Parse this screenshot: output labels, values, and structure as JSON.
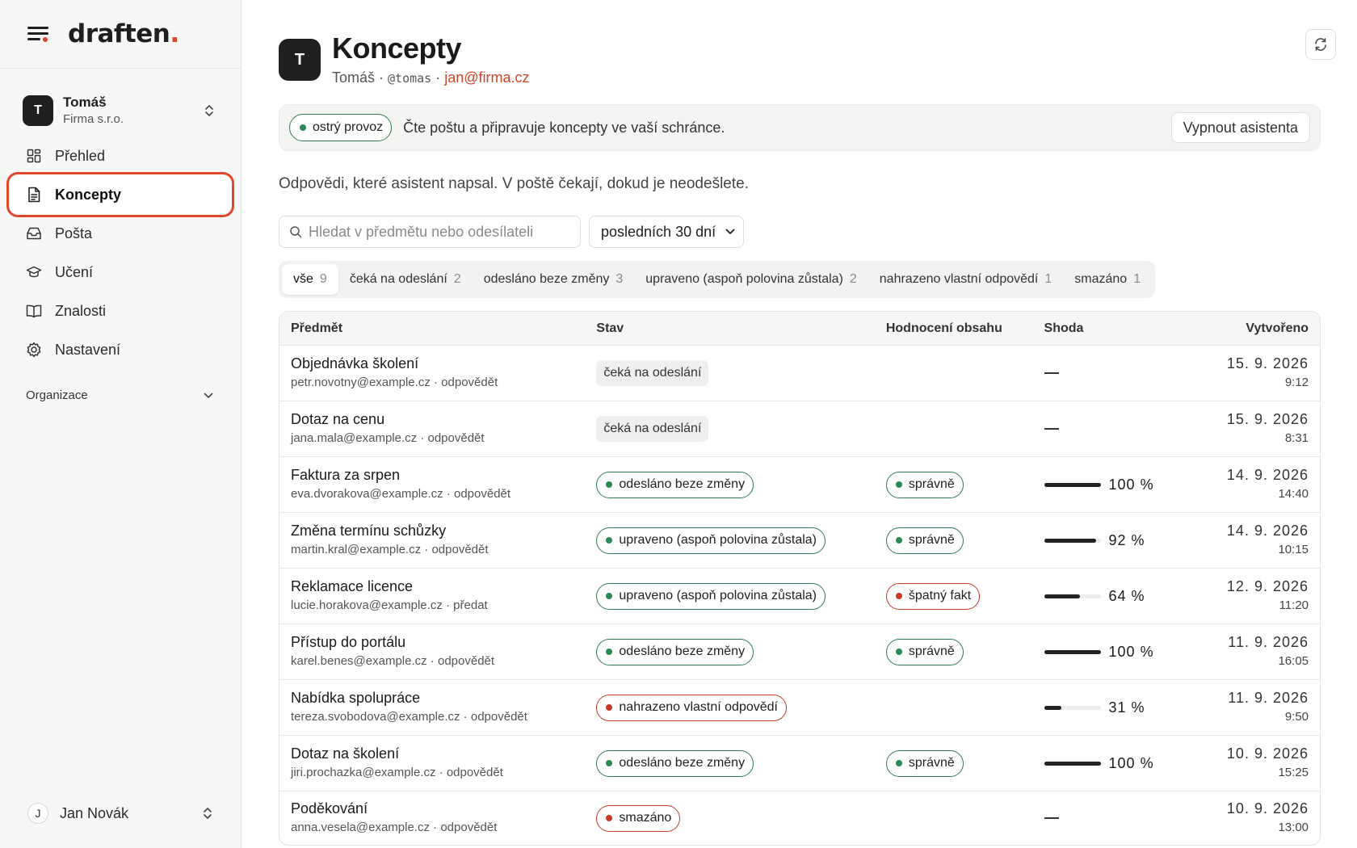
{
  "brand": {
    "logo": "draften",
    "logo_dot": "."
  },
  "account": {
    "initial": "T",
    "name": "Tomáš",
    "org": "Firma s.r.o."
  },
  "nav": [
    {
      "label": "Přehled",
      "icon": "grid-icon"
    },
    {
      "label": "Koncepty",
      "icon": "document-icon",
      "active": true
    },
    {
      "label": "Pošta",
      "icon": "inbox-icon"
    },
    {
      "label": "Učení",
      "icon": "graduation-cap-icon"
    },
    {
      "label": "Znalosti",
      "icon": "book-icon"
    },
    {
      "label": "Nastavení",
      "icon": "gear-icon"
    }
  ],
  "organization_section": "Organizace",
  "user": {
    "initial": "J",
    "name": "Jan Novák"
  },
  "header": {
    "initial": "T",
    "title": "Koncepty",
    "name": "Tomáš",
    "handle": "@tomas",
    "email": "jan@firma.cz",
    "separator": " · "
  },
  "status": {
    "pill": "ostrý provoz",
    "text": "Čte poštu a připravuje koncepty ve vaší schránce.",
    "button": "Vypnout asistenta"
  },
  "intro": "Odpovědi, které asistent napsal. V poště čekají, dokud je neodešlete.",
  "search": {
    "placeholder": "Hledat v předmětu nebo odesílateli"
  },
  "period": {
    "selected": "posledních 30 dní"
  },
  "tabs": [
    {
      "label": "vše",
      "count": "9"
    },
    {
      "label": "čeká na odeslání",
      "count": "2"
    },
    {
      "label": "odesláno beze změny",
      "count": "3"
    },
    {
      "label": "upraveno (aspoň polovina zůstala)",
      "count": "2"
    },
    {
      "label": "nahrazeno vlastní odpovědí",
      "count": "1"
    },
    {
      "label": "smazáno",
      "count": "1"
    }
  ],
  "columns": {
    "subject": "Předmět",
    "state": "Stav",
    "rating": "Hodnocení obsahu",
    "match": "Shoda",
    "created": "Vytvořeno"
  },
  "colors": {
    "accent": "#d8482a",
    "green": "#2a8a55",
    "red": "#c53a26"
  },
  "rows": [
    {
      "subject": "Objednávka školení",
      "sender": "petr.novotny@example.cz",
      "action": "odpovědět",
      "state": "čeká na odeslání",
      "state_kind": "gray",
      "rating": "",
      "rating_kind": "",
      "match_text": "—",
      "match": null,
      "date": "15. 9. 2026",
      "time": "9:12"
    },
    {
      "subject": "Dotaz na cenu",
      "sender": "jana.mala@example.cz",
      "action": "odpovědět",
      "state": "čeká na odeslání",
      "state_kind": "gray",
      "rating": "",
      "rating_kind": "",
      "match_text": "—",
      "match": null,
      "date": "15. 9. 2026",
      "time": "8:31"
    },
    {
      "subject": "Faktura za srpen",
      "sender": "eva.dvorakova@example.cz",
      "action": "odpovědět",
      "state": "odesláno beze změny",
      "state_kind": "green",
      "rating": "správně",
      "rating_kind": "green",
      "match_text": "100 %",
      "match": 100,
      "date": "14. 9. 2026",
      "time": "14:40"
    },
    {
      "subject": "Změna termínu schůzky",
      "sender": "martin.kral@example.cz",
      "action": "odpovědět",
      "state": "upraveno (aspoň polovina zůstala)",
      "state_kind": "green",
      "rating": "správně",
      "rating_kind": "green",
      "match_text": "92 %",
      "match": 92,
      "date": "14. 9. 2026",
      "time": "10:15"
    },
    {
      "subject": "Reklamace licence",
      "sender": "lucie.horakova@example.cz",
      "action": "předat",
      "state": "upraveno (aspoň polovina zůstala)",
      "state_kind": "green",
      "rating": "špatný fakt",
      "rating_kind": "red",
      "match_text": "64 %",
      "match": 64,
      "date": "12. 9. 2026",
      "time": "11:20"
    },
    {
      "subject": "Přístup do portálu",
      "sender": "karel.benes@example.cz",
      "action": "odpovědět",
      "state": "odesláno beze změny",
      "state_kind": "green",
      "rating": "správně",
      "rating_kind": "green",
      "match_text": "100 %",
      "match": 100,
      "date": "11. 9. 2026",
      "time": "16:05"
    },
    {
      "subject": "Nabídka spolupráce",
      "sender": "tereza.svobodova@example.cz",
      "action": "odpovědět",
      "state": "nahrazeno vlastní odpovědí",
      "state_kind": "red",
      "rating": "",
      "rating_kind": "",
      "match_text": "31 %",
      "match": 31,
      "date": "11. 9. 2026",
      "time": "9:50"
    },
    {
      "subject": "Dotaz na školení",
      "sender": "jiri.prochazka@example.cz",
      "action": "odpovědět",
      "state": "odesláno beze změny",
      "state_kind": "green",
      "rating": "správně",
      "rating_kind": "green",
      "match_text": "100 %",
      "match": 100,
      "date": "10. 9. 2026",
      "time": "15:25"
    },
    {
      "subject": "Poděkování",
      "sender": "anna.vesela@example.cz",
      "action": "odpovědět",
      "state": "smazáno",
      "state_kind": "red",
      "rating": "",
      "rating_kind": "",
      "match_text": "—",
      "match": null,
      "date": "10. 9. 2026",
      "time": "13:00"
    }
  ]
}
